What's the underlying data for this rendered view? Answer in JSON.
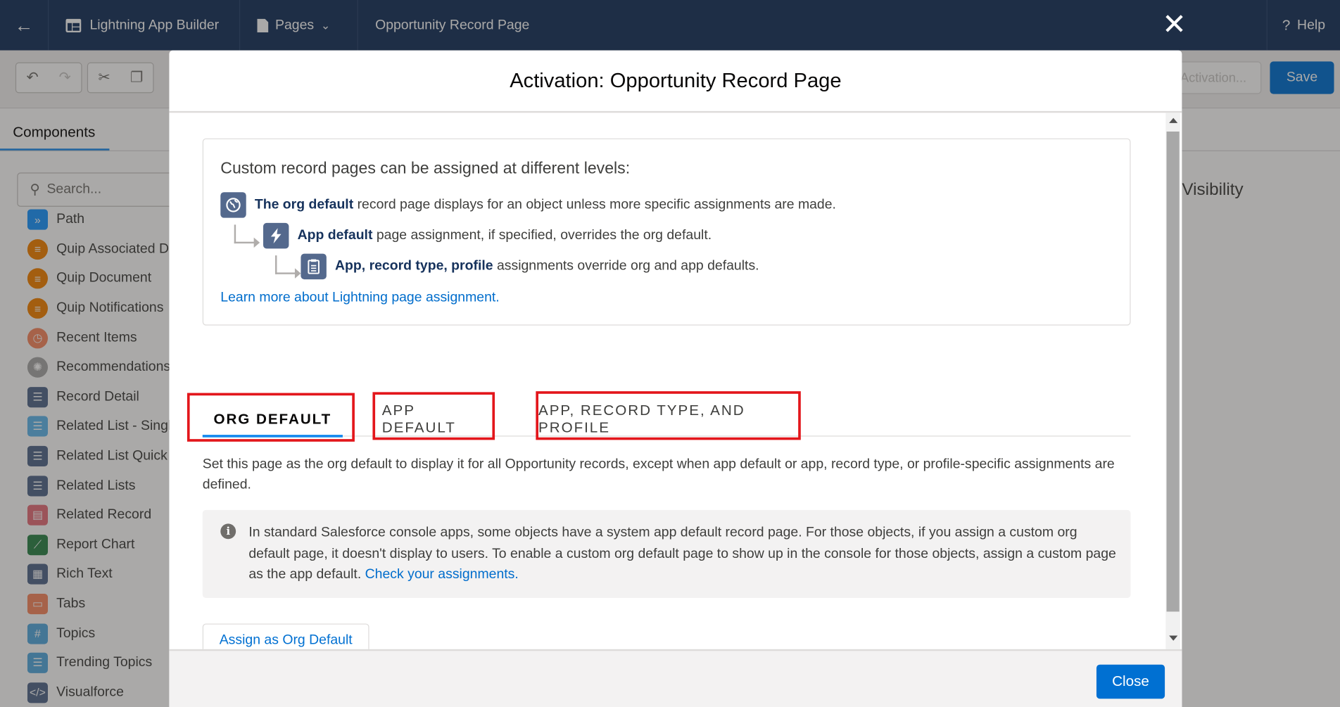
{
  "topbar": {
    "app_title": "Lightning App Builder",
    "pages_label": "Pages",
    "page_title": "Opportunity Record Page",
    "help_label": "Help"
  },
  "toolbar": {
    "activation_label": "Activation...",
    "save_label": "Save"
  },
  "sidebar": {
    "tab_label": "Components",
    "search_placeholder": "Search...",
    "items": [
      {
        "label": "Path",
        "icon": "path-icon",
        "color": "#1b96ff"
      },
      {
        "label": "Quip Associated Documents",
        "icon": "quip-icon",
        "color": "#f38303"
      },
      {
        "label": "Quip Document",
        "icon": "quip-icon",
        "color": "#f38303"
      },
      {
        "label": "Quip Notifications",
        "icon": "quip-icon",
        "color": "#f38303"
      },
      {
        "label": "Recent Items",
        "icon": "clock-icon",
        "color": "#f88962"
      },
      {
        "label": "Recommendations",
        "icon": "lightbulb-icon",
        "color": "#a8a8a8"
      },
      {
        "label": "Record Detail",
        "icon": "list-icon",
        "color": "#54698d"
      },
      {
        "label": "Related List - Single",
        "icon": "list-icon",
        "color": "#62b7ed"
      },
      {
        "label": "Related List Quick Links",
        "icon": "list-icon",
        "color": "#54698d"
      },
      {
        "label": "Related Lists",
        "icon": "list-icon",
        "color": "#54698d"
      },
      {
        "label": "Related Record",
        "icon": "record-icon",
        "color": "#e6717c"
      },
      {
        "label": "Report Chart",
        "icon": "chart-icon",
        "color": "#2e844a"
      },
      {
        "label": "Rich Text",
        "icon": "text-icon",
        "color": "#54698d"
      },
      {
        "label": "Tabs",
        "icon": "tabs-icon",
        "color": "#f88962"
      },
      {
        "label": "Topics",
        "icon": "hash-icon",
        "color": "#56aadf"
      },
      {
        "label": "Trending Topics",
        "icon": "list-icon",
        "color": "#56aadf"
      },
      {
        "label": "Visualforce",
        "icon": "code-icon",
        "color": "#54698d"
      }
    ]
  },
  "right_panel": {
    "visibility_label": "Visibility"
  },
  "modal": {
    "title": "Activation: Opportunity Record Page",
    "info": {
      "heading": "Custom record pages can be assigned at different levels:",
      "org_bold": "The org default",
      "org_text": " record page displays for an object unless more specific assignments are made.",
      "app_bold": "App default",
      "app_text": " page assignment, if specified, overrides the org default.",
      "profile_bold": "App, record type, profile",
      "profile_text": " assignments override org and app defaults.",
      "learn_link": "Learn more about Lightning page assignment."
    },
    "tabs": [
      {
        "label": "ORG DEFAULT",
        "active": true
      },
      {
        "label": "APP DEFAULT",
        "active": false
      },
      {
        "label": "APP, RECORD TYPE, AND PROFILE",
        "active": false
      }
    ],
    "description": "Set this page as the org default to display it for all Opportunity records, except when app default or app, record type, or profile-specific assignments are defined.",
    "note_text": "In standard Salesforce console apps, some objects have a system app default record page. For those objects, if you assign a custom org default page, it doesn't display to users. To enable a custom org default page to show up in the console for those objects, assign a custom page as the app default. ",
    "note_link": "Check your assignments.",
    "assign_button": "Assign as Org Default",
    "close_button": "Close"
  },
  "colors": {
    "header_bg": "#16325c",
    "brand_blue": "#0070d2",
    "highlight_red": "#e3161b"
  }
}
